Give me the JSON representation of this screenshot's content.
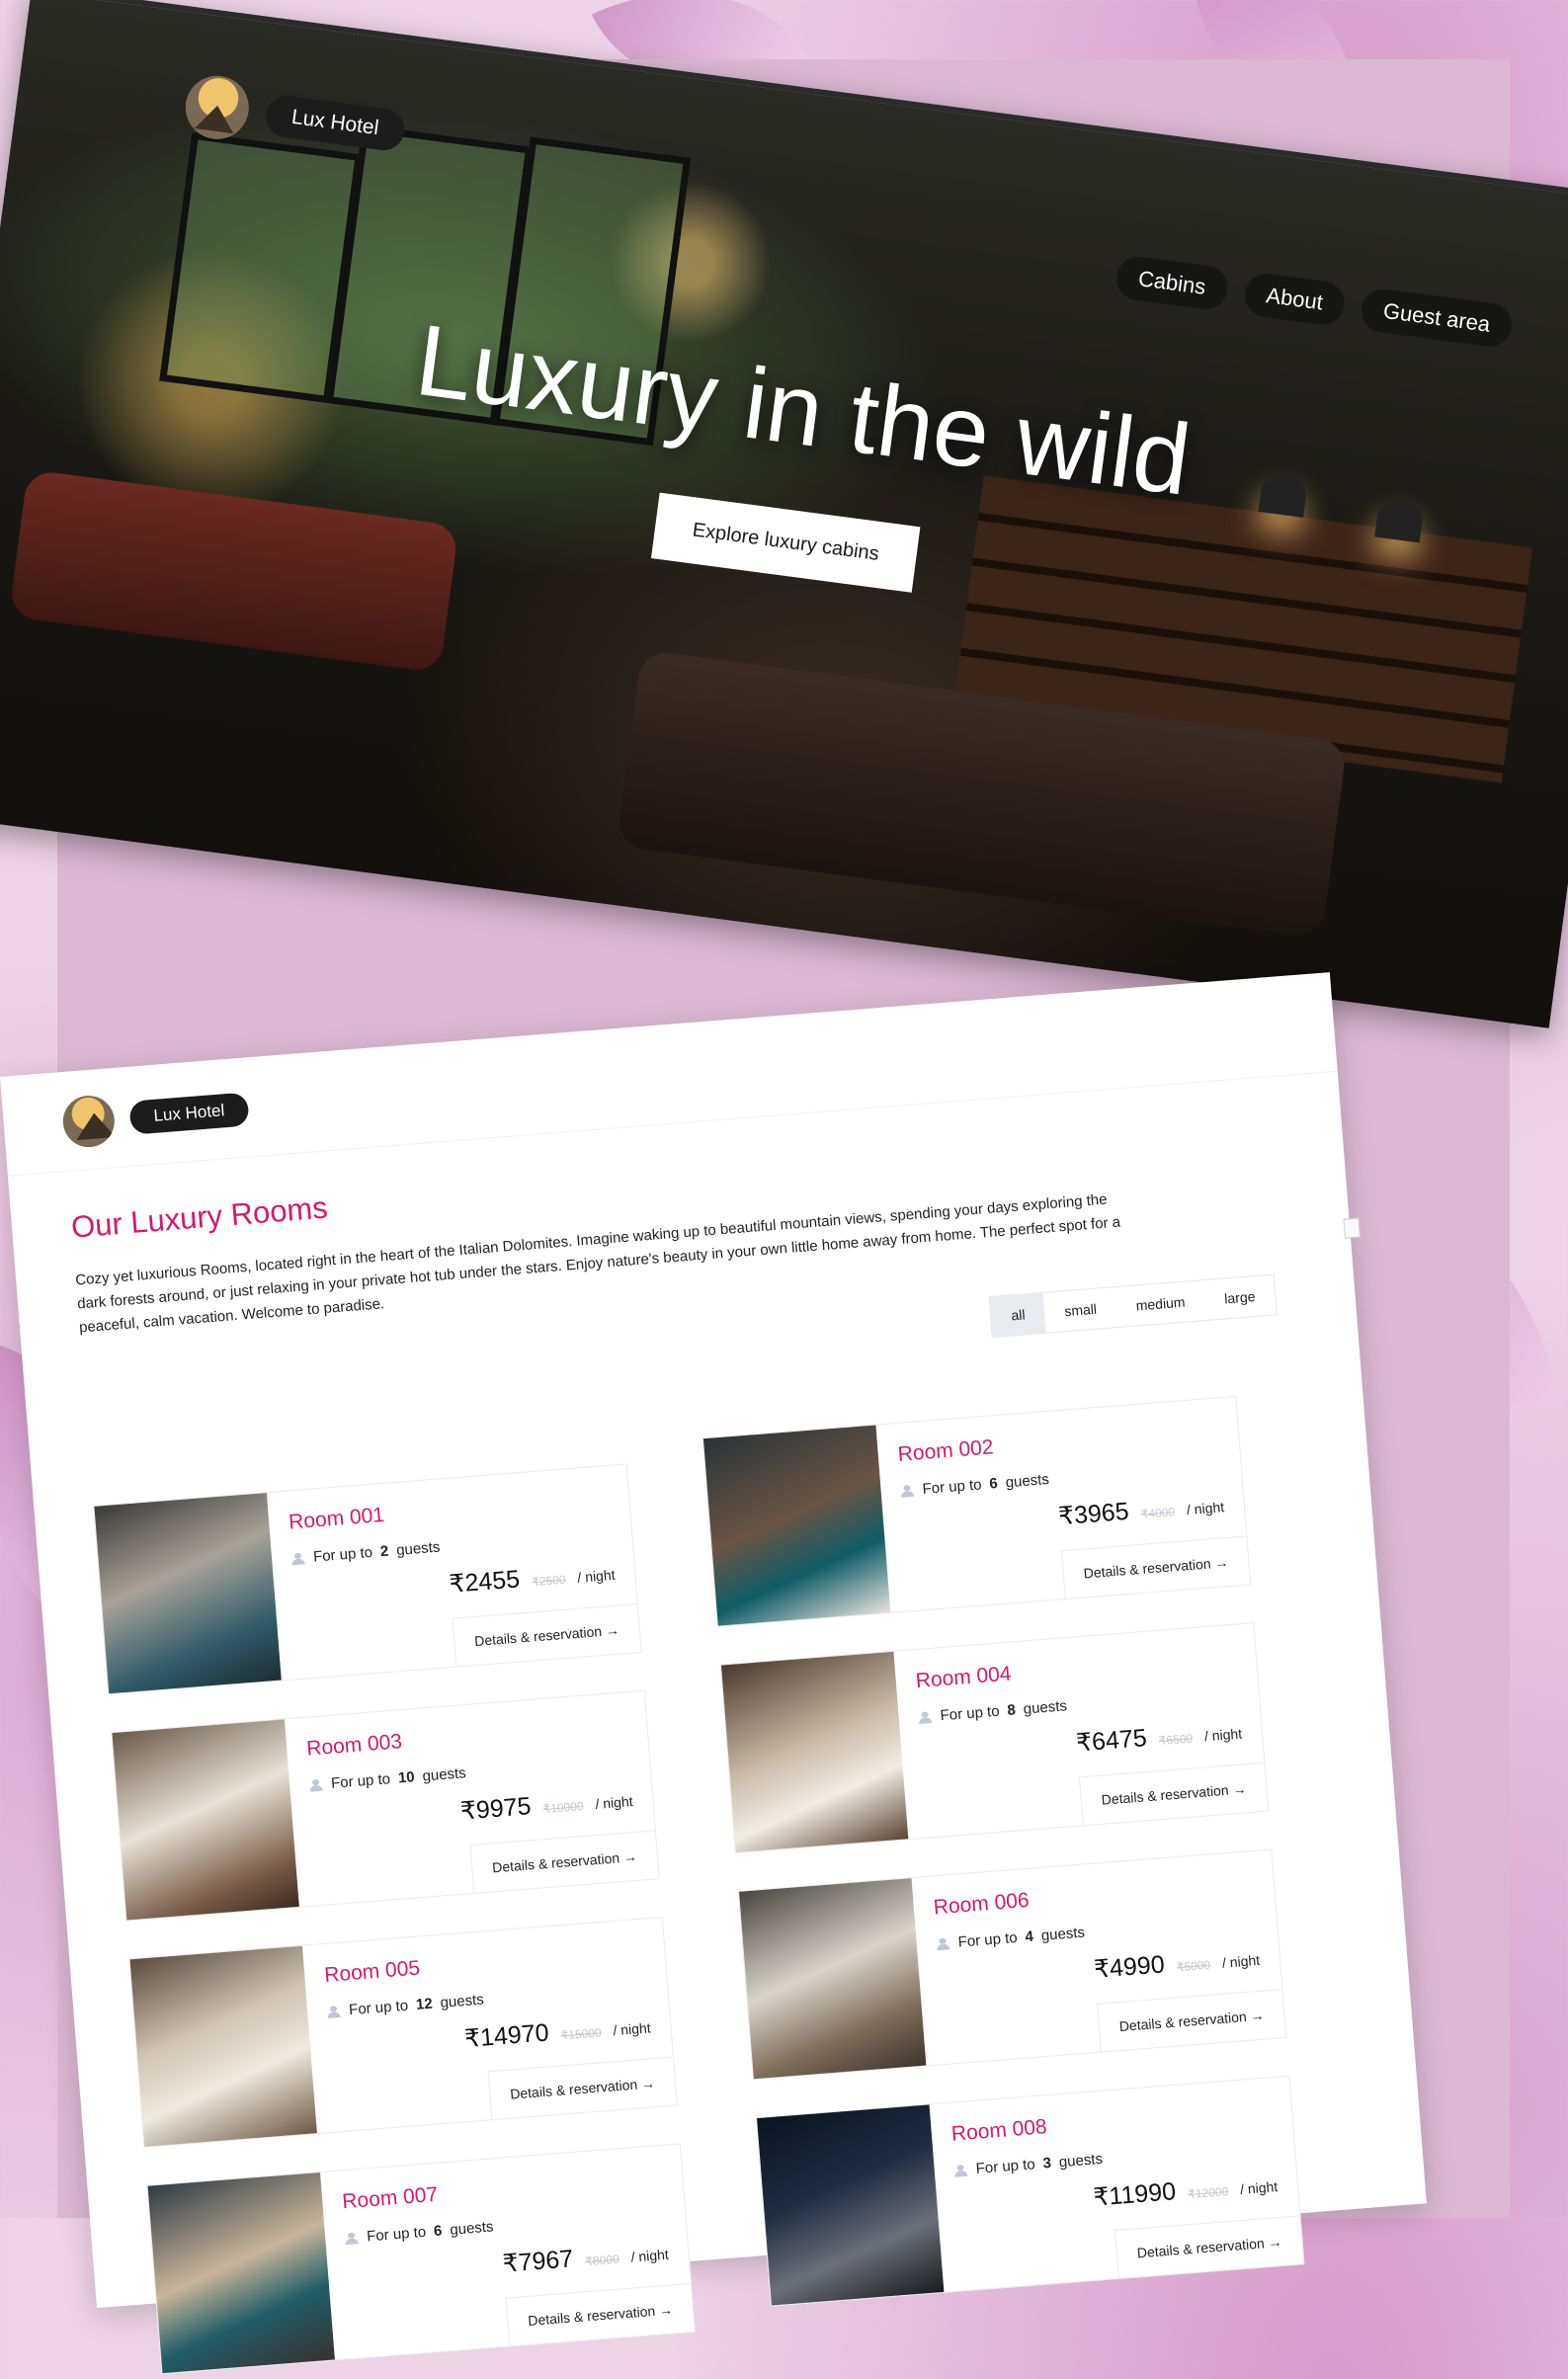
{
  "hero": {
    "brand": "Lux Hotel",
    "nav": [
      "Cabins",
      "About",
      "Guest area"
    ],
    "title": "Luxury in the wild",
    "cta": "Explore luxury cabins"
  },
  "rooms_page": {
    "brand": "Lux Hotel",
    "section_title": "Our Luxury Rooms",
    "description": "Cozy yet luxurious Rooms, located right in the heart of the Italian Dolomites. Imagine waking up to beautiful mountain views, spending your days exploring the dark forests around, or just relaxing in your private hot tub under the stars. Enjoy nature's beauty in your own little home away from home. The perfect spot for a peaceful, calm vacation. Welcome to paradise.",
    "filters": [
      "all",
      "small",
      "medium",
      "large"
    ],
    "active_filter": "all",
    "guests_prefix": "For up to",
    "guests_suffix": "guests",
    "per_night": "/ night",
    "details_label": "Details & reservation →",
    "rooms": [
      {
        "name": "Room 001",
        "guests": "2",
        "price": "₹2455",
        "old_price": "₹2500"
      },
      {
        "name": "Room 002",
        "guests": "6",
        "price": "₹3965",
        "old_price": "₹4000"
      },
      {
        "name": "Room 003",
        "guests": "10",
        "price": "₹9975",
        "old_price": "₹10000"
      },
      {
        "name": "Room 004",
        "guests": "8",
        "price": "₹6475",
        "old_price": "₹6500"
      },
      {
        "name": "Room 005",
        "guests": "12",
        "price": "₹14970",
        "old_price": "₹15000"
      },
      {
        "name": "Room 006",
        "guests": "4",
        "price": "₹4990",
        "old_price": "₹5000"
      },
      {
        "name": "Room 007",
        "guests": "6",
        "price": "₹7967",
        "old_price": "₹8000"
      },
      {
        "name": "Room 008",
        "guests": "3",
        "price": "₹11990",
        "old_price": "₹12000"
      }
    ]
  },
  "colors": {
    "accent": "#d31970",
    "background": "#ecd3e6",
    "dark_pill": "#1c1c1c"
  }
}
